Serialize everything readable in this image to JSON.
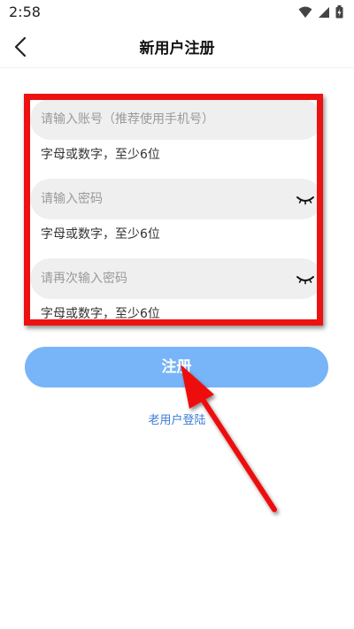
{
  "status_bar": {
    "time": "2:58",
    "icons": [
      "wifi-icon",
      "signal-icon",
      "battery-icon"
    ]
  },
  "header": {
    "back_icon": "back-arrow-icon",
    "title": "新用户注册"
  },
  "form": {
    "account": {
      "placeholder": "请输入账号（推荐使用手机号）",
      "value": "",
      "hint": "字母或数字，至少6位"
    },
    "password": {
      "placeholder": "请输入密码",
      "value": "",
      "hint": "字母或数字，至少6位",
      "toggle_icon": "eye-closed-icon"
    },
    "confirm_password": {
      "placeholder": "请再次输入密码",
      "value": "",
      "hint": "字母或数字，至少6位",
      "toggle_icon": "eye-closed-icon"
    }
  },
  "actions": {
    "register_label": "注册",
    "old_user_label": "老用户登陆"
  },
  "colors": {
    "button_bg": "#78b4f8",
    "link": "#3a7bd5",
    "annotation": "#ee1111"
  }
}
